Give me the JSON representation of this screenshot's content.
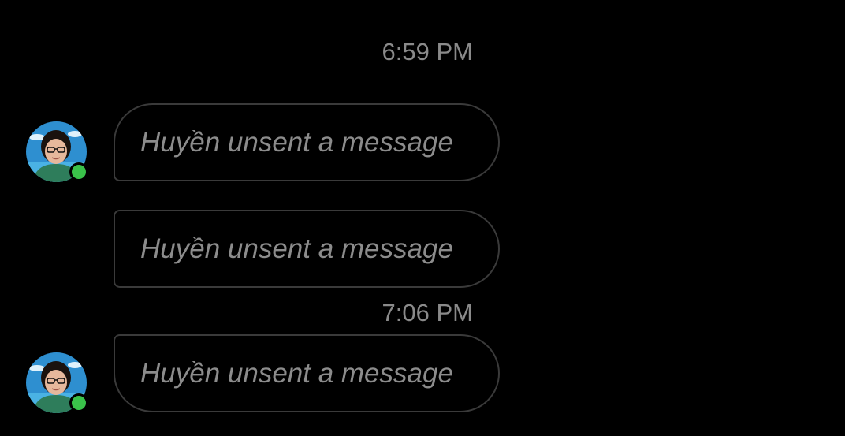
{
  "conversation": {
    "groups": [
      {
        "timestamp": "6:59 PM",
        "messages": [
          {
            "text": "Huyền unsent a message"
          },
          {
            "text": "Huyền unsent a message"
          }
        ]
      },
      {
        "timestamp": "7:06 PM",
        "messages": [
          {
            "text": "Huyền unsent a message"
          }
        ]
      }
    ],
    "contact": {
      "avatar_icon": "user-avatar-photo",
      "status": "online",
      "status_color": "#3ac24a"
    }
  },
  "theme": {
    "background": "#000000",
    "bubble_border": "#3a3a3a",
    "text_muted": "#8c8c8c"
  }
}
